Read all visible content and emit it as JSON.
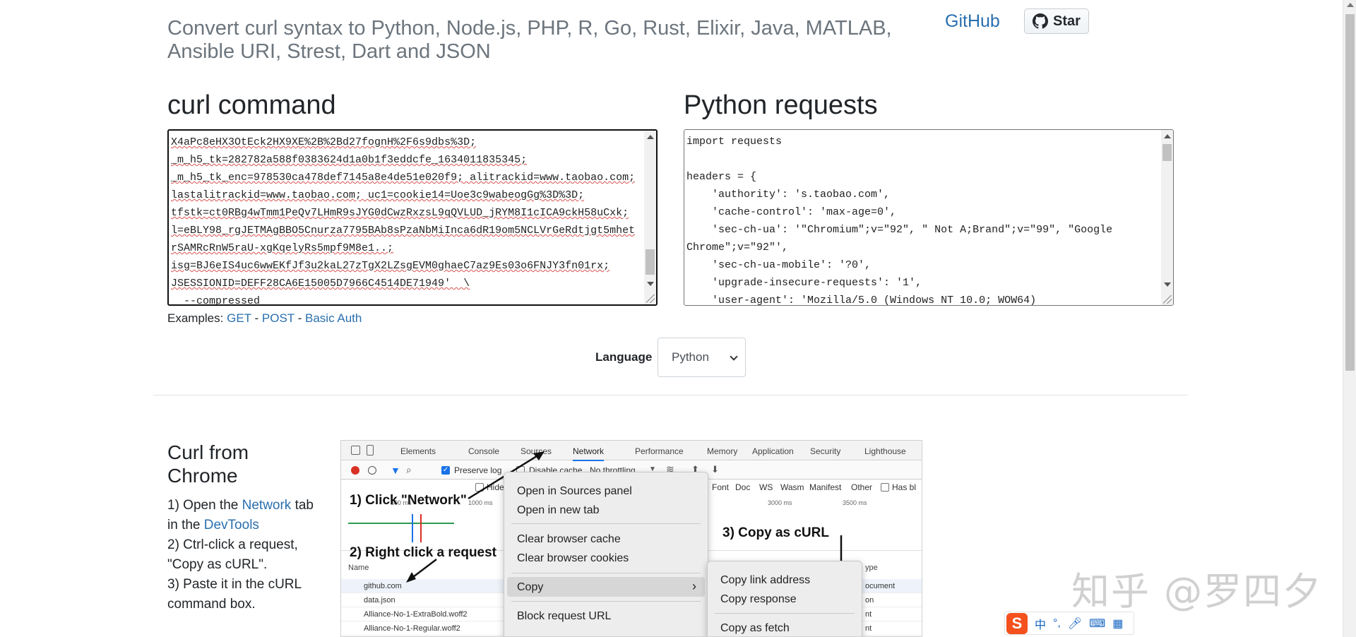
{
  "header": {
    "subtitle": "Convert curl syntax to Python, Node.js, PHP, R, Go, Rust, Elixir, Java, MATLAB, Ansible URI, Strest, Dart and JSON",
    "github_link": "GitHub",
    "star_label": "Star"
  },
  "curl": {
    "heading": "curl command",
    "lines": [
      "X4aPc8eHX3OtEck2HX9XE%2B%2Bd27fognH%2F6s9dbs%3D;",
      "_m_h5_tk=282782a588f0383624d1a0b1f3eddcfe_1634011835345;",
      "_m_h5_tk_enc=978530ca478def7145a8e4de51e020f9; alitrackid=www.taobao.com;",
      "lastalitrackid=www.taobao.com; uc1=cookie14=Uoe3c9wabeogGg%3D%3D;",
      "tfstk=ct0RBg4wTmm1PeQv7LHmR9sJYG0dCwzRxzsL9qQVLUD_jRYM8I1cICA9ckH58uCxk;",
      "l=eBLY98_rgJETMAgBBO5Cnurza7795BAb8sPzaNbMiInca6dR19om5NCLVrGeRdtjgt5mhet",
      "rSAMRcRnW5raU-xgKqelyRs5mpf9M8e1..;",
      "isg=BJ6eIS4uc6wwEKfJf3u2kaL27zTgX2LZsgEVM0ghaeC7az9Es03o6FNJY3fn01rx;",
      "JSESSIONID=DEFF28CA6E15005D7966C4514DE71949'  \\",
      "  --compressed"
    ]
  },
  "examples": {
    "prefix": "Examples:",
    "get": "GET",
    "post": "POST",
    "basic_auth": "Basic Auth",
    "sep": "-"
  },
  "python": {
    "heading": "Python requests",
    "lines": [
      "import requests",
      "",
      "headers = {",
      "    'authority': 's.taobao.com',",
      "    'cache-control': 'max-age=0',",
      "    'sec-ch-ua': '\"Chromium\";v=\"92\", \" Not A;Brand\";v=\"99\", \"Google",
      "Chrome\";v=\"92\"',",
      "    'sec-ch-ua-mobile': '?0',",
      "    'upgrade-insecure-requests': '1',",
      "    'user-agent': 'Mozilla/5.0 (Windows NT 10.0; WOW64)"
    ]
  },
  "language": {
    "label": "Language",
    "selected": "Python"
  },
  "chrome": {
    "title": "Curl from Chrome",
    "step1_a": "1) Open the ",
    "step1_link": "Network",
    "step1_b": " tab in the ",
    "step1_link2": "DevTools",
    "step2": "2) Ctrl-click a request, \"Copy as cURL\".",
    "step3": "3) Paste it in the cURL command box."
  },
  "devtools": {
    "tabs": [
      "Elements",
      "Console",
      "Sources",
      "Network",
      "Performance",
      "Memory",
      "Application",
      "Security",
      "Lighthouse"
    ],
    "active_tab": "Network",
    "preserve_log": "Preserve log",
    "disable_cache": "Disable cache",
    "throttling": "No throttling",
    "hide": "Hide",
    "filters": [
      "Font",
      "Doc",
      "WS",
      "Wasm",
      "Manifest",
      "Other"
    ],
    "has_bl": "Has bl",
    "time_ticks": [
      "500 ms",
      "1000 ms",
      "3000 ms",
      "3500 ms"
    ],
    "name_header": "Name",
    "type_header": "ype",
    "rows": [
      "github.com",
      "data.json",
      "Alliance-No-1-ExtraBold.woff2",
      "Alliance-No-1-Regular.woff2"
    ],
    "row_types": [
      "ocument",
      "on",
      "nt",
      "nt"
    ],
    "anno1": "1) Click \"Network\"",
    "anno2": "2) Right click a request",
    "anno3": "3) Copy as cURL",
    "menu1": [
      "Open in Sources panel",
      "Open in new tab",
      "Clear browser cache",
      "Clear browser cookies",
      "Copy",
      "Block request URL"
    ],
    "menu2": [
      "Copy link address",
      "Copy response",
      "Copy as fetch"
    ]
  },
  "watermark": "知乎 @罗四夕",
  "ime": {
    "logo": "S",
    "lang": "中"
  }
}
